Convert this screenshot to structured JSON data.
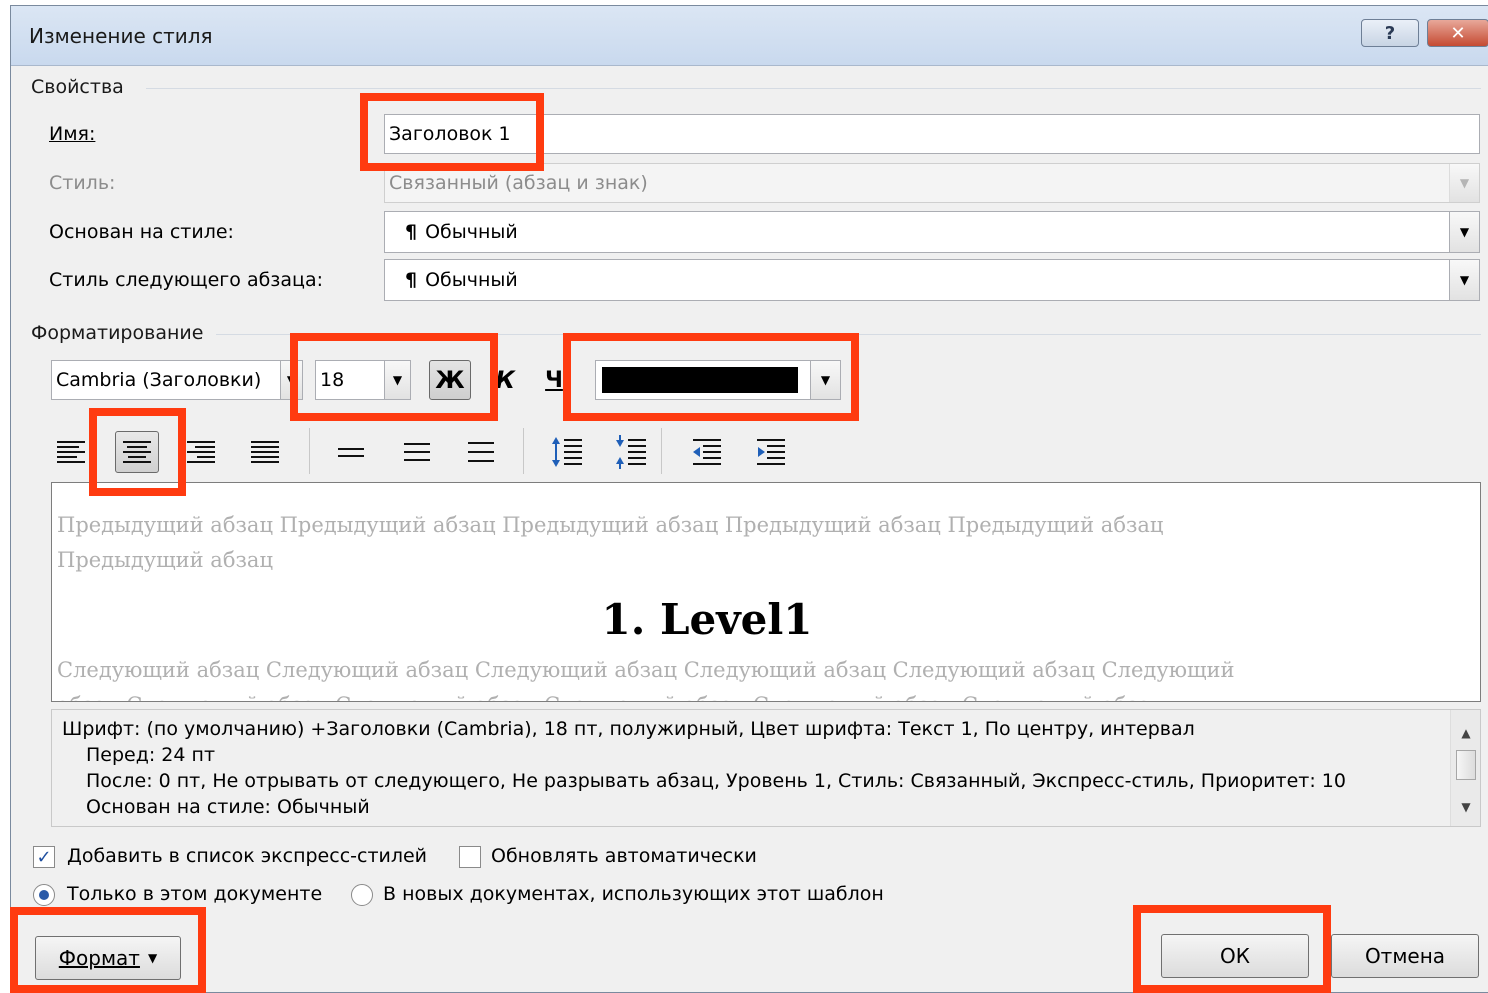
{
  "window": {
    "title": "Изменение стиля",
    "help_label": "?",
    "close_label": "✕"
  },
  "properties": {
    "section_label": "Свойства",
    "name_label": "Имя:",
    "name_value": "Заголовок 1",
    "style_type_label": "Стиль:",
    "style_type_value": "Связанный (абзац и знак)",
    "based_on_label": "Основан на стиле:",
    "based_on_value": "Обычный",
    "next_style_label": "Стиль следующего абзаца:",
    "next_style_value": "Обычный",
    "pilcrow": "¶"
  },
  "formatting": {
    "section_label": "Форматирование",
    "font_value": "Cambria (Заголовки)",
    "size_value": "18",
    "bold_label": "Ж",
    "italic_label": "К",
    "underline_label": "Ч",
    "color_value": "#000000"
  },
  "preview": {
    "previous_line1": "Предыдущий абзац Предыдущий абзац Предыдущий абзац Предыдущий абзац Предыдущий абзац",
    "previous_line2": "Предыдущий абзац",
    "heading": "1. Level1",
    "next_line1": "Следующий абзац Следующий абзац Следующий абзац Следующий абзац Следующий абзац Следующий",
    "next_line2": "абзац Следующий абзац Следующий абзац Следующий абзац Следующий абзац Следующий абзац"
  },
  "description": {
    "line1": "Шрифт: (по умолчанию) +Заголовки (Cambria), 18 пт, полужирный, Цвет шрифта: Текст 1, По центру, интервал",
    "line2": "Перед:  24 пт",
    "line3": "После:  0 пт, Не отрывать от следующего, Не разрывать абзац, Уровень 1, Стиль: Связанный, Экспресс-стиль, Приоритет: 10",
    "line4": "Основан на стиле: Обычный"
  },
  "options": {
    "add_quick_styles_label": "Добавить в список экспресс-стилей",
    "add_quick_styles_checked": true,
    "auto_update_label": "Обновлять автоматически",
    "auto_update_checked": false,
    "only_this_doc_label": "Только в этом документе",
    "new_docs_label": "В новых документах, использующих этот шаблон"
  },
  "buttons": {
    "format_label": "Формат",
    "ok_label": "ОК",
    "cancel_label": "Отмена"
  },
  "colors": {
    "highlight": "#ff3b10",
    "titlebar": "#c9d9ee"
  }
}
